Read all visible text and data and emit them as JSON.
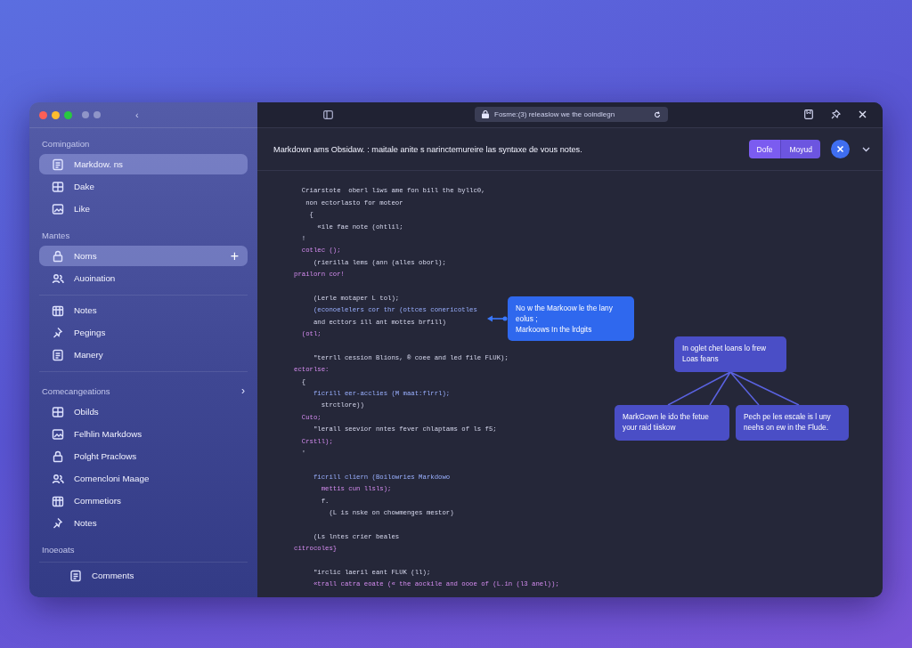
{
  "sidebar": {
    "toolbar_glyph": "‹",
    "sections": [
      {
        "label": "Comingation",
        "items": [
          {
            "label": "Markdow. ns",
            "selected": true
          },
          {
            "label": "Dake",
            "selected": false
          },
          {
            "label": "Like",
            "selected": false
          }
        ]
      },
      {
        "label": "Mantes",
        "items": [
          {
            "label": "Noms",
            "selected": true,
            "action": "+"
          },
          {
            "label": "Auoination",
            "selected": false
          }
        ]
      },
      {
        "items": [
          {
            "label": "Notes",
            "selected": false
          },
          {
            "label": "Pegings",
            "selected": false
          },
          {
            "label": "Manery",
            "selected": false
          }
        ]
      },
      {
        "label": "Comecangeations",
        "chevron": "›",
        "items": [
          {
            "label": "Obilds",
            "selected": false
          },
          {
            "label": "Felhlin Markdows",
            "selected": false
          },
          {
            "label": "Polght Praclows",
            "selected": false
          },
          {
            "label": "Comencloni Maage",
            "selected": false
          },
          {
            "label": "Commetiors",
            "selected": false
          },
          {
            "label": "Notes",
            "selected": false
          }
        ]
      },
      {
        "label": "Inoeoats",
        "items": [
          {
            "label": "Comments",
            "selected": false,
            "indented": true
          }
        ]
      }
    ]
  },
  "address_bar": {
    "text": "Fosme:(3) releaslow we the ooindlegn"
  },
  "header": {
    "title": "Markdown ams Obsidaw. : maitale anite s narinctemureire las syntaxe de vous notes.",
    "buttons": [
      "Dofe",
      "Moyud"
    ]
  },
  "code": [
    {
      "kind": "blank"
    },
    {
      "kind": "code",
      "text": "  Criarstote  oberl liws ame fon bill the byllc0,"
    },
    {
      "kind": "code",
      "text": "   non ectorlasto for moteor"
    },
    {
      "kind": "code",
      "text": "    {"
    },
    {
      "kind": "code",
      "text": "      «ile fae note (ohtlil;"
    },
    {
      "kind": "code",
      "text": "  !"
    },
    {
      "kind": "keyword",
      "text": "  cotlec ();"
    },
    {
      "kind": "code",
      "text": "     (rierilla lems (ann (alles oborl);"
    },
    {
      "kind": "keyword",
      "text": "prailorn cor!"
    },
    {
      "kind": "blank"
    },
    {
      "kind": "code",
      "text": "     (Lerle motaper L tol);"
    },
    {
      "kind": "accent",
      "text": "     (econoelelers cor thr (ottces conericotles"
    },
    {
      "kind": "code",
      "text": "     and ecttors ill ant mottes brfill)"
    },
    {
      "kind": "keyword",
      "text": "  (otl;"
    },
    {
      "kind": "blank"
    },
    {
      "kind": "code",
      "text": "     \"terrll cession Blions, ® coee and led file FLUK);"
    },
    {
      "kind": "keyword",
      "text": "ectorlse:"
    },
    {
      "kind": "code",
      "text": "  {"
    },
    {
      "kind": "accent",
      "text": "     ficrill eer-acclies (M maat:flrrl);"
    },
    {
      "kind": "code",
      "text": "       strctlore))"
    },
    {
      "kind": "keyword",
      "text": "  Cuto;"
    },
    {
      "kind": "code",
      "text": "     \"lerall seevior nntes fever chlaptams of ls f5;"
    },
    {
      "kind": "keyword",
      "text": "  Crstll);"
    },
    {
      "kind": "code",
      "text": "  '"
    },
    {
      "kind": "blank"
    },
    {
      "kind": "accent",
      "text": "     ficrill cliern (Boilowries Markdowo"
    },
    {
      "kind": "keyword",
      "text": "       mettis cun llsls);"
    },
    {
      "kind": "code",
      "text": "       f."
    },
    {
      "kind": "code",
      "text": "         (L is nske on chowmenges mestor)"
    },
    {
      "kind": "blank"
    },
    {
      "kind": "code",
      "text": "     (Ls lntes crier beales"
    },
    {
      "kind": "keyword",
      "text": "citrocoles}"
    },
    {
      "kind": "blank"
    },
    {
      "kind": "code",
      "text": "     \"irclic laeril eant FLUK (ll);"
    },
    {
      "kind": "keyword",
      "text": "     «trall catra eoate (« the aockile and oooe of (L.in (l3 anel));"
    }
  ],
  "diagram": {
    "callout": "No w the Markoow le the lany eolus ;\nMarkoows In the lrdgits",
    "root": "In oglet chet loans lo frew Loas feans",
    "children": [
      "MarkGown le ido the fetue your raid tiiskow",
      "Pech pe les escale is l uny neehs on ew in the Flude."
    ]
  }
}
